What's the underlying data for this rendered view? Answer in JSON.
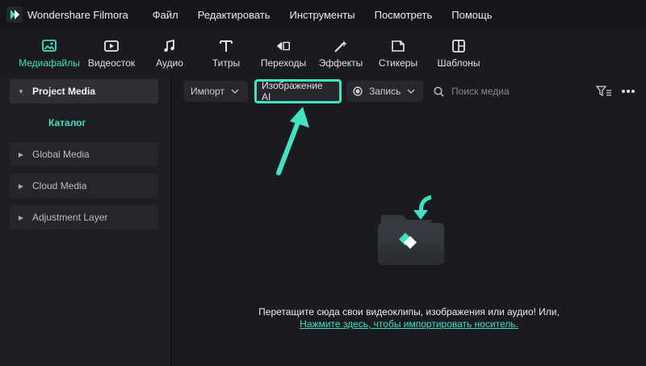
{
  "app": {
    "name": "Wondershare Filmora"
  },
  "menu": [
    "Файл",
    "Редактировать",
    "Инструменты",
    "Посмотреть",
    "Помощь"
  ],
  "toolbar": {
    "items": [
      {
        "label": "Медиафайлы",
        "icon": "media-icon",
        "active": true
      },
      {
        "label": "Видеосток",
        "icon": "stock-video-icon"
      },
      {
        "label": "Аудио",
        "icon": "music-note-icon"
      },
      {
        "label": "Титры",
        "icon": "text-icon"
      },
      {
        "label": "Переходы",
        "icon": "transitions-icon"
      },
      {
        "label": "Эффекты",
        "icon": "effects-icon"
      },
      {
        "label": "Стикеры",
        "icon": "stickers-icon"
      },
      {
        "label": "Шаблоны",
        "icon": "templates-icon"
      }
    ]
  },
  "sidebar": {
    "project_media": "Project Media",
    "catalog": "Каталог",
    "global_media": "Global Media",
    "cloud_media": "Cloud Media",
    "adjustment_layer": "Adjustment Layer"
  },
  "media_toolbar": {
    "import": "Импорт",
    "ai_image": "Изображение AI",
    "record": "Запись",
    "search_placeholder": "Поиск медиа"
  },
  "empty_state": {
    "line1": "Перетащите сюда свои видеоклипы, изображения или аудио! Или,",
    "link": "Нажмите здесь, чтобы импортировать носитель."
  },
  "colors": {
    "accent": "#3fe0c3",
    "highlight": "#43e3c2"
  }
}
